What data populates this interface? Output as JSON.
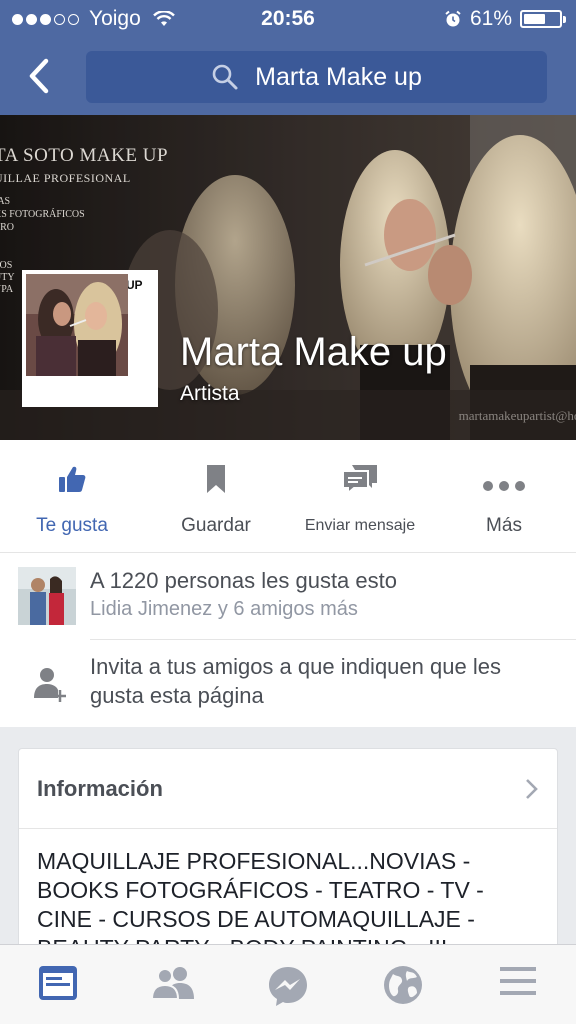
{
  "status_bar": {
    "carrier": "Yoigo",
    "time": "20:56",
    "battery_percent": "61%",
    "battery_level": 0.61
  },
  "search": {
    "query": "Marta Make up"
  },
  "cover": {
    "caption_title": "TA SOTO MAKE UP",
    "caption_subtitle": "UILLAE PROFESIONAL",
    "caption_list": [
      "IAS",
      "KS FOTOGRÁFICOS",
      "TRO"
    ],
    "caption_list2": [
      "SOS",
      "UTY",
      "YPA"
    ],
    "watermark": "martamakeupartist@hot"
  },
  "profile": {
    "logo_text": "#MARTA MAKE UP",
    "name": "Marta Make up",
    "category": "Artista"
  },
  "actions": [
    {
      "label": "Te gusta",
      "icon": "thumbs-up-icon"
    },
    {
      "label": "Guardar",
      "icon": "bookmark-icon"
    },
    {
      "label": "Enviar mensaje",
      "icon": "message-icon"
    },
    {
      "label": "Más",
      "icon": "more-icon"
    }
  ],
  "likes": {
    "count_text": "A 1220 personas les gusta esto",
    "friends_text": "Lidia Jimenez y 6 amigos más"
  },
  "invite": {
    "text": "Invita a tus amigos a que indiquen que les gusta esta página"
  },
  "info": {
    "title": "Información",
    "body": "MAQUILLAJE PROFESIONAL...NOVIAS - BOOKS FOTOGRÁFICOS - TEATRO - TV - CINE - CURSOS DE AUTOMAQUILLAJE - BEAUTY PARTY - BODY PAINTING - III"
  },
  "tabs": [
    {
      "icon": "news-feed-icon",
      "active": true
    },
    {
      "icon": "friends-icon",
      "active": false
    },
    {
      "icon": "messenger-icon",
      "active": false
    },
    {
      "icon": "globe-icon",
      "active": false
    },
    {
      "icon": "menu-icon",
      "active": false
    }
  ],
  "colors": {
    "header": "#4e69a2",
    "search_bg": "#3b5998",
    "accent": "#4267b2",
    "tab_inactive": "#a3a8b3"
  }
}
